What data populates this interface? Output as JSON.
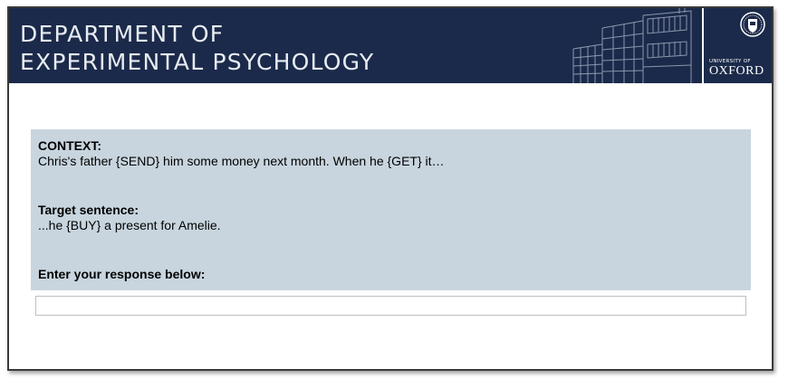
{
  "header": {
    "dept_line1": "DEPARTMENT OF",
    "dept_line2": "EXPERIMENTAL PSYCHOLOGY",
    "university_of": "UNIVERSITY OF",
    "oxford": "OXFORD",
    "banner_color": "#1b2a4a"
  },
  "panel": {
    "context_label": "CONTEXT:",
    "context_text": "Chris's father {SEND} him some money next month. When he {GET} it…",
    "target_label": "Target sentence:",
    "target_text": "...he {BUY} a present for Amelie.",
    "response_label": "Enter your response below:",
    "background_color": "#c8d5de"
  },
  "response": {
    "value": "",
    "placeholder": ""
  }
}
